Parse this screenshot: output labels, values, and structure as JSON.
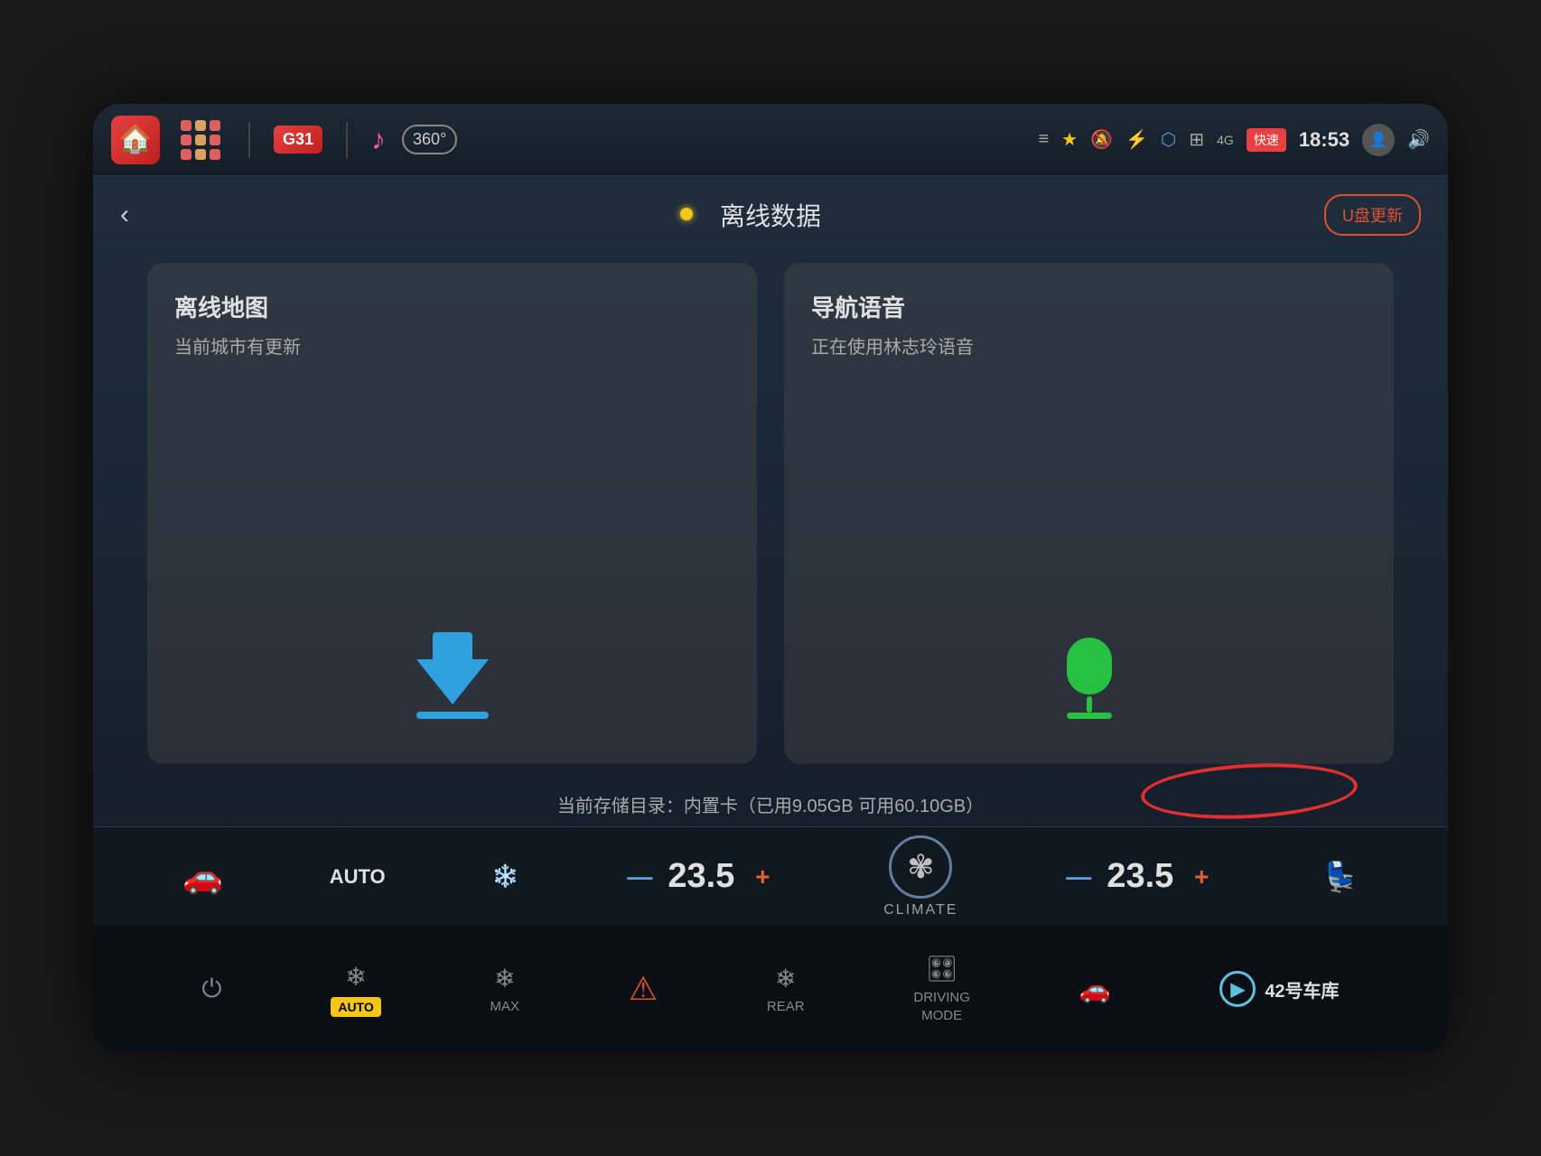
{
  "topbar": {
    "g31_label": "G31",
    "vr_label": "360°",
    "kuaisu_label": "快速",
    "time": "18:53",
    "usb_update_label": "U盘更新"
  },
  "subheader": {
    "title": "离线数据",
    "back_label": "‹"
  },
  "card_map": {
    "title": "离线地图",
    "subtitle": "当前城市有更新"
  },
  "card_voice": {
    "title": "导航语音",
    "subtitle": "正在使用林志玲语音"
  },
  "storage": {
    "text": "当前存储目录：内置卡（已用9.05GB 可用60.10GB）"
  },
  "climate": {
    "auto_label": "AUTO",
    "center_label": "CLIMATE",
    "temp_left": "23.5",
    "temp_right": "23.5",
    "minus_label": "—",
    "plus_label": "+"
  },
  "physbar": {
    "auto_label": "AUTO",
    "max_label": "MAX",
    "rear_label": "REAR",
    "driving_mode_label": "DRIVING\nMODE",
    "brand_label": "42号车库"
  }
}
